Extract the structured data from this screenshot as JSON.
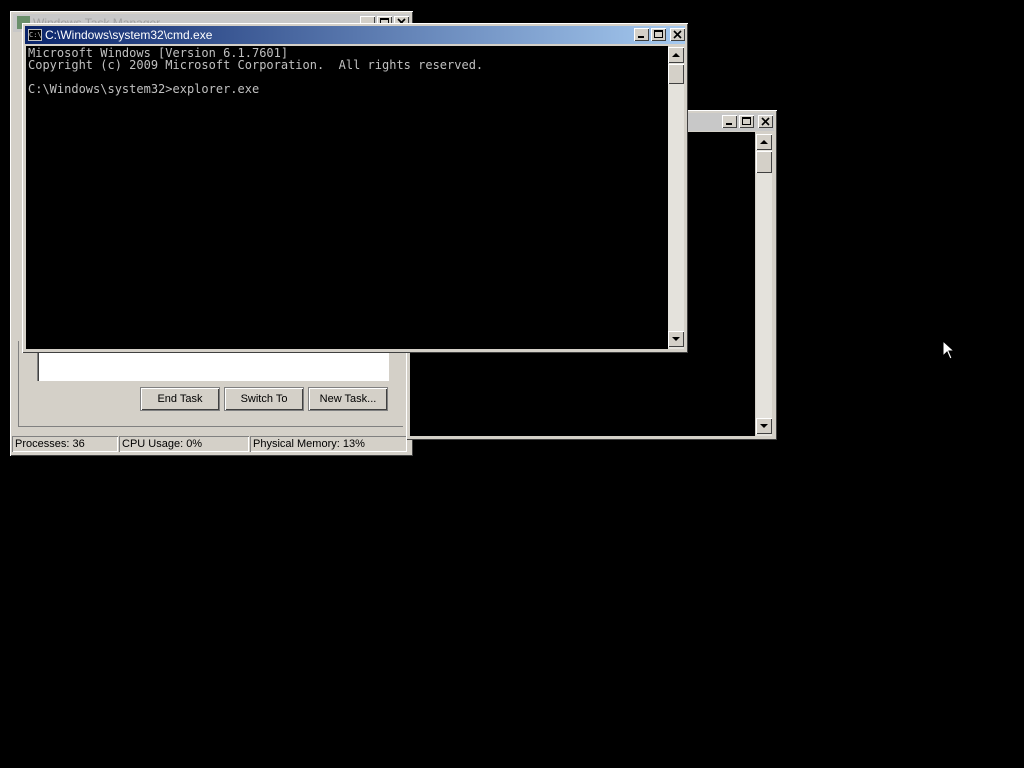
{
  "cmd_window": {
    "title": "C:\\Windows\\system32\\cmd.exe",
    "console_lines": [
      "Microsoft Windows [Version 6.1.7601]",
      "Copyright (c) 2009 Microsoft Corporation.  All rights reserved.",
      "",
      "C:\\Windows\\system32>explorer.exe"
    ]
  },
  "task_manager": {
    "title": "Windows Task Manager",
    "buttons": {
      "end_task": "End Task",
      "switch_to": "Switch To",
      "new_task": "New Task..."
    },
    "status": {
      "processes": "Processes: 36",
      "cpu": "CPU Usage: 0%",
      "memory": "Physical Memory: 13%"
    }
  },
  "colors": {
    "desktop": "#000000",
    "title_active_start": "#0a246a",
    "title_active_end": "#a6caf0",
    "window_face": "#d4d0c8"
  },
  "icons": [
    "cmd-icon",
    "minimize-icon",
    "maximize-icon",
    "close-icon",
    "scroll-up-icon",
    "scroll-down-icon",
    "mouse-cursor-icon"
  ]
}
